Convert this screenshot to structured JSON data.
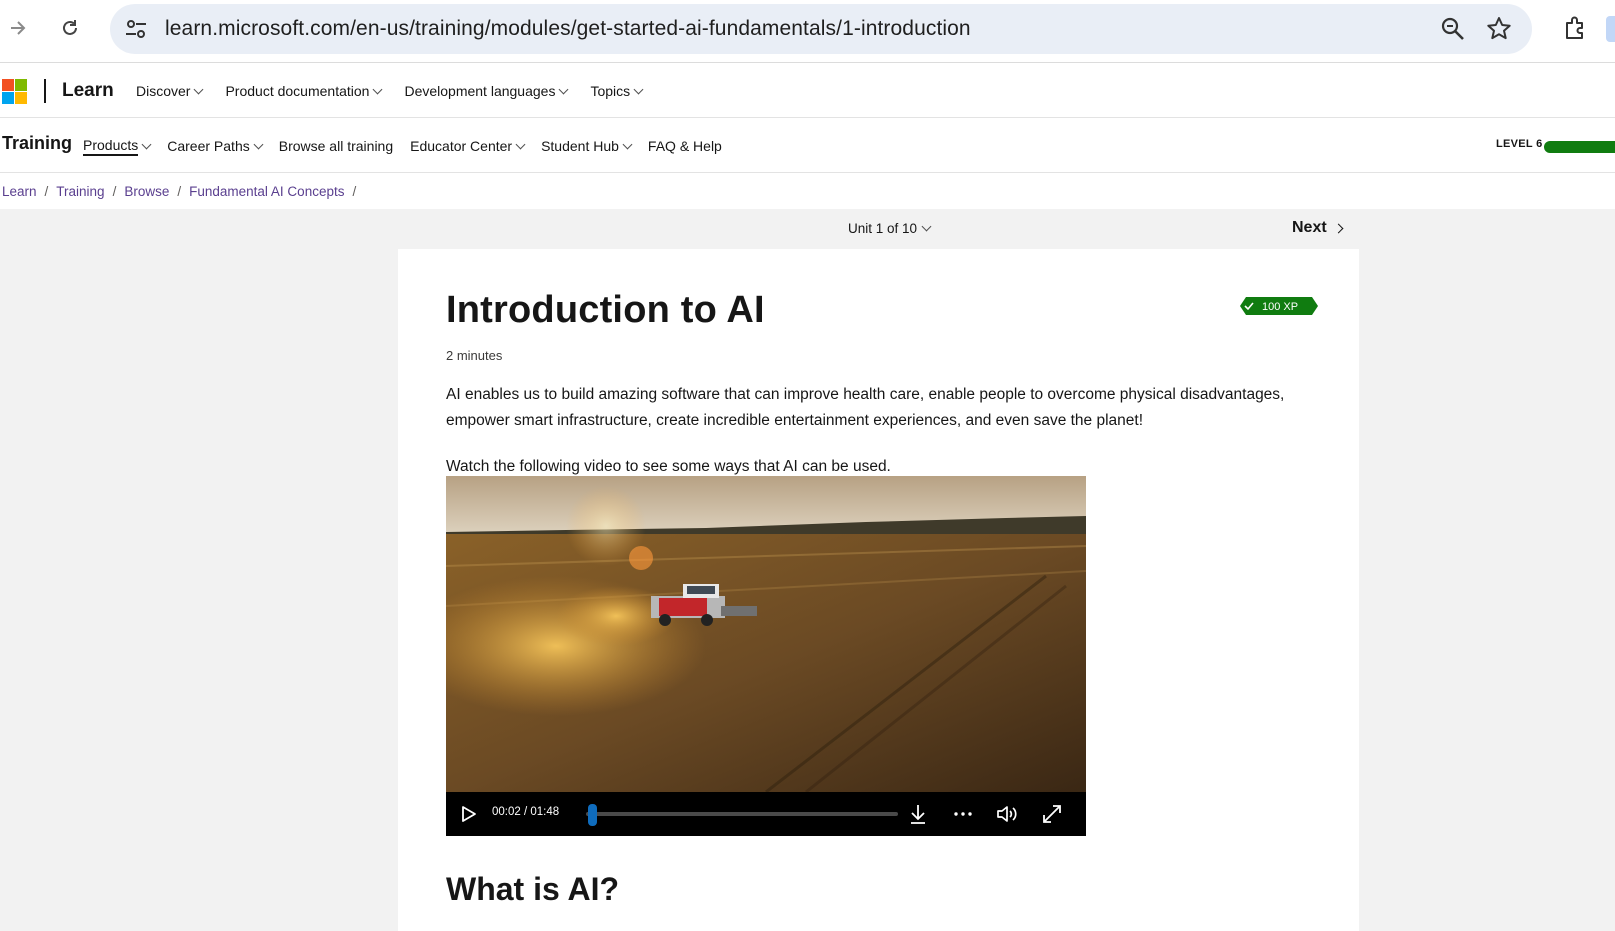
{
  "browser": {
    "url": "learn.microsoft.com/en-us/training/modules/get-started-ai-fundamentals/1-introduction",
    "icons": [
      "forward-icon",
      "reload-icon",
      "site-settings-icon",
      "zoom-icon",
      "bookmark-star-icon",
      "extensions-icon"
    ]
  },
  "header": {
    "brand": "Learn",
    "nav": [
      {
        "label": "Discover"
      },
      {
        "label": "Product documentation"
      },
      {
        "label": "Development languages"
      },
      {
        "label": "Topics"
      }
    ]
  },
  "training_nav": {
    "title": "Training",
    "items": [
      {
        "label": "Products",
        "has_dropdown": true,
        "active": true
      },
      {
        "label": "Career Paths",
        "has_dropdown": true
      },
      {
        "label": "Browse all training",
        "has_dropdown": false
      },
      {
        "label": "Educator Center",
        "has_dropdown": true
      },
      {
        "label": "Student Hub",
        "has_dropdown": true
      },
      {
        "label": "FAQ & Help",
        "has_dropdown": false
      }
    ],
    "level_label": "LEVEL 6"
  },
  "breadcrumb": [
    "Learn",
    "Training",
    "Browse",
    "Fundamental AI Concepts"
  ],
  "unit_nav": {
    "unit_label": "Unit 1 of 10",
    "next_label": "Next"
  },
  "article": {
    "title": "Introduction to AI",
    "xp": "100 XP",
    "duration": "2 minutes",
    "paragraph1": "AI enables us to build amazing software that can improve health care, enable people to overcome physical disadvantages, empower smart infrastructure, create incredible entertainment experiences, and even save the planet!",
    "paragraph2": "Watch the following video to see some ways that AI can be used.",
    "video": {
      "time": "00:02 / 01:48",
      "progress": 0.02
    },
    "section_heading": "What is AI?"
  },
  "colors": {
    "accent_green": "#107c10",
    "link_purple": "#5a3f8f",
    "progress_blue": "#0f6cbd"
  }
}
